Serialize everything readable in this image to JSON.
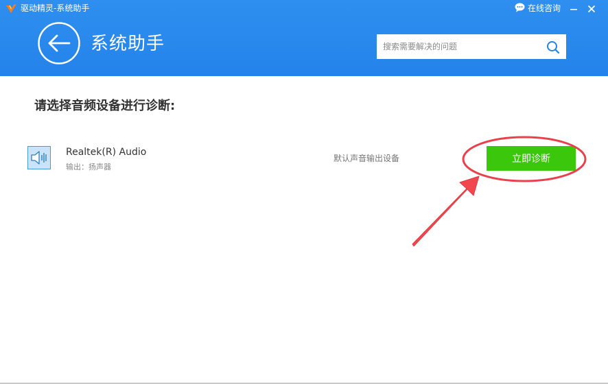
{
  "window": {
    "title": "驱动精灵-系统助手",
    "consult_label": "在线咨询"
  },
  "header": {
    "page_title": "系统助手",
    "search_placeholder": "搜索需要解决的问题"
  },
  "main": {
    "section_title": "请选择音频设备进行诊断:",
    "devices": [
      {
        "name": "Realtek(R) Audio",
        "subtitle": "输出：扬声器",
        "role": "默认声音输出设备",
        "action_label": "立即诊断",
        "icon": "speaker-icon"
      }
    ]
  },
  "colors": {
    "header_blue": "#2383ea",
    "action_green": "#3bc70b",
    "annotation_red": "#e8414b"
  }
}
